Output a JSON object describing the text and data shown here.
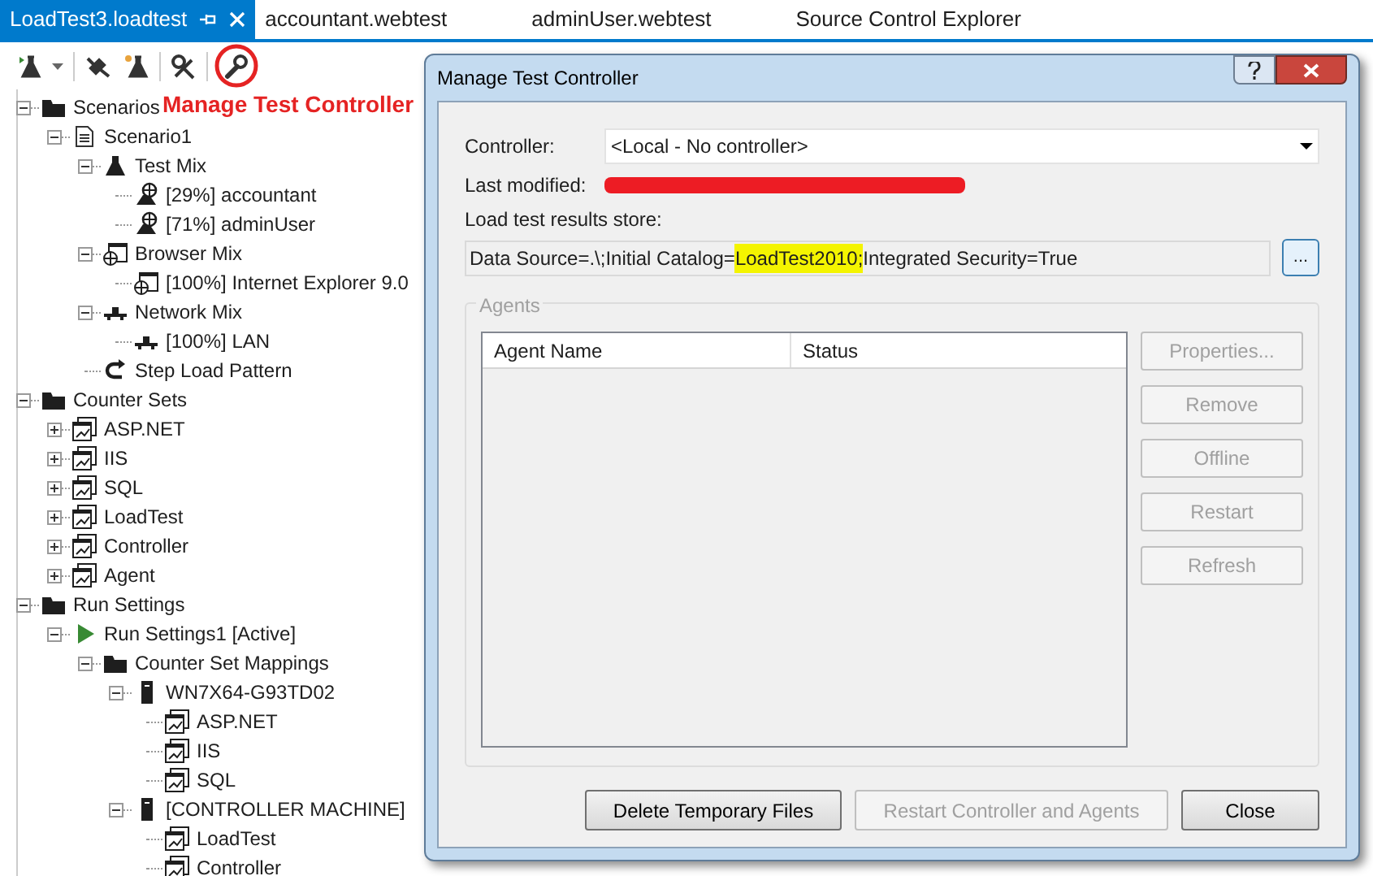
{
  "tabs": [
    {
      "label": "LoadTest3.loadtest",
      "selected": true
    },
    {
      "label": "accountant.webtest",
      "selected": false
    },
    {
      "label": "adminUser.webtest",
      "selected": false
    },
    {
      "label": "Source Control Explorer",
      "selected": false
    }
  ],
  "annotation": {
    "text": "Manage Test Controller"
  },
  "tree": [
    {
      "label": "Scenarios",
      "kind": "folder",
      "expanded": true,
      "children": [
        {
          "label": "Scenario1",
          "kind": "scenario",
          "expanded": true,
          "children": [
            {
              "label": "Test Mix",
              "kind": "flask",
              "expanded": true,
              "children": [
                {
                  "label": "[29%] accountant",
                  "kind": "webtest"
                },
                {
                  "label": "[71%] adminUser",
                  "kind": "webtest"
                }
              ]
            },
            {
              "label": "Browser Mix",
              "kind": "browser",
              "expanded": true,
              "children": [
                {
                  "label": "[100%] Internet Explorer 9.0",
                  "kind": "browser"
                }
              ]
            },
            {
              "label": "Network Mix",
              "kind": "network",
              "expanded": true,
              "children": [
                {
                  "label": "[100%] LAN",
                  "kind": "network"
                }
              ]
            },
            {
              "label": "Step Load Pattern",
              "kind": "step"
            }
          ]
        }
      ]
    },
    {
      "label": "Counter Sets",
      "kind": "folder",
      "expanded": true,
      "children": [
        {
          "label": "ASP.NET",
          "kind": "counter",
          "expanded": false
        },
        {
          "label": "IIS",
          "kind": "counter",
          "expanded": false
        },
        {
          "label": "SQL",
          "kind": "counter",
          "expanded": false
        },
        {
          "label": "LoadTest",
          "kind": "counter",
          "expanded": false
        },
        {
          "label": "Controller",
          "kind": "counter",
          "expanded": false
        },
        {
          "label": "Agent",
          "kind": "counter",
          "expanded": false
        }
      ]
    },
    {
      "label": "Run Settings",
      "kind": "folder",
      "expanded": true,
      "children": [
        {
          "label": "Run Settings1 [Active]",
          "kind": "play",
          "expanded": true,
          "children": [
            {
              "label": "Counter Set Mappings",
              "kind": "folder",
              "expanded": true,
              "children": [
                {
                  "label": "WN7X64-G93TD02",
                  "kind": "server",
                  "expanded": true,
                  "children": [
                    {
                      "label": "ASP.NET",
                      "kind": "counter"
                    },
                    {
                      "label": "IIS",
                      "kind": "counter"
                    },
                    {
                      "label": "SQL",
                      "kind": "counter"
                    }
                  ]
                },
                {
                  "label": "[CONTROLLER MACHINE]",
                  "kind": "server",
                  "expanded": true,
                  "children": [
                    {
                      "label": "LoadTest",
                      "kind": "counter"
                    },
                    {
                      "label": "Controller",
                      "kind": "counter"
                    }
                  ]
                }
              ]
            }
          ]
        }
      ]
    }
  ],
  "dialog": {
    "title": "Manage Test Controller",
    "controller_label": "Controller:",
    "controller_value": "<Local - No controller>",
    "last_modified_label": "Last modified:",
    "last_modified_redacted": true,
    "store_label": "Load test results store:",
    "store_value": [
      {
        "text": "Data Source=.\\;Initial Catalog=",
        "highlighted": false
      },
      {
        "text": "LoadTest2010;",
        "highlighted": true
      },
      {
        "text": "Integrated Security=True",
        "highlighted": false
      }
    ],
    "browse_button": "...",
    "agents_group": "Agents",
    "columns": [
      "Agent Name",
      "Status"
    ],
    "side_buttons": [
      {
        "label": "Properties...",
        "disabled": true
      },
      {
        "label": "Remove",
        "disabled": true
      },
      {
        "label": "Offline",
        "disabled": true
      },
      {
        "label": "Restart",
        "disabled": true
      },
      {
        "label": "Refresh",
        "disabled": true
      }
    ],
    "bottom_buttons": [
      {
        "label": "Delete Temporary Files",
        "disabled": false
      },
      {
        "label": "Restart Controller and Agents",
        "disabled": true
      },
      {
        "label": "Close",
        "disabled": false
      }
    ]
  }
}
